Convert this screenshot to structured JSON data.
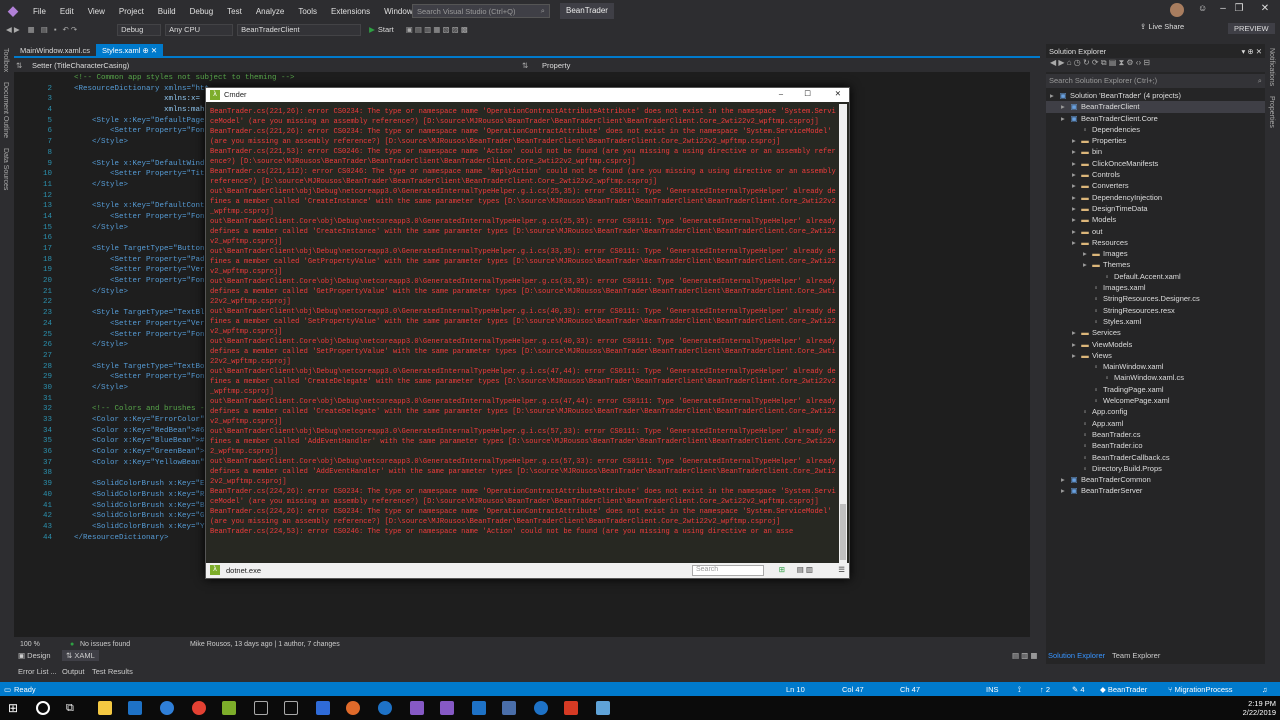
{
  "app": {
    "menu": [
      "File",
      "Edit",
      "View",
      "Project",
      "Build",
      "Debug",
      "Test",
      "Analyze",
      "Tools",
      "Extensions",
      "Window",
      "Help"
    ],
    "search_placeholder": "Search Visual Studio (Ctrl+Q)",
    "solution": "BeanTrader",
    "liveshare": "Live Share",
    "preview": "PREVIEW"
  },
  "toolbar": {
    "config": "Debug",
    "platform": "Any CPU",
    "startup": "BeanTraderClient",
    "start": "Start"
  },
  "left_tabs": [
    "Toolbox",
    "Document Outline",
    "Data Sources"
  ],
  "right_tabs": [
    "Notifications",
    "Properties"
  ],
  "doc_tabs": [
    {
      "label": "MainWindow.xaml.cs"
    },
    {
      "label": "Styles.xaml"
    }
  ],
  "nav": {
    "left": "Setter (TitleCharacterCasing)",
    "right": "Property"
  },
  "code": [
    {
      "n": "",
      "t": "<!-- Common app styles not subject to theming -->",
      "c": "ccom",
      "i": 4
    },
    {
      "n": "2",
      "t": "<ResourceDictionary xmlns=\"htt",
      "c": "cxml",
      "i": 0
    },
    {
      "n": "3",
      "t": "                    xmlns:x=",
      "c": "cattr",
      "i": 0
    },
    {
      "n": "4",
      "t": "                    xmlns:mah",
      "c": "cattr",
      "i": 0
    },
    {
      "n": "5",
      "t": "    <Style x:Key=\"DefaultPageS",
      "c": "cxml",
      "i": 0
    },
    {
      "n": "6",
      "t": "        <Setter Property=\"Font",
      "c": "cxml",
      "i": 0
    },
    {
      "n": "7",
      "t": "    </Style>",
      "c": "cxml",
      "i": 0
    },
    {
      "n": "8",
      "t": "",
      "c": "ctext",
      "i": 0
    },
    {
      "n": "9",
      "t": "    <Style x:Key=\"DefaultWindo",
      "c": "cxml",
      "i": 0
    },
    {
      "n": "10",
      "t": "        <Setter Property=\"Tit",
      "c": "cxml",
      "i": 0
    },
    {
      "n": "11",
      "t": "    </Style>",
      "c": "cxml",
      "i": 0
    },
    {
      "n": "12",
      "t": "",
      "c": "ctext",
      "i": 0
    },
    {
      "n": "13",
      "t": "    <Style x:Key=\"DefaultContr",
      "c": "cxml",
      "i": 0
    },
    {
      "n": "14",
      "t": "        <Setter Property=\"Font",
      "c": "cxml",
      "i": 0
    },
    {
      "n": "15",
      "t": "    </Style>",
      "c": "cxml",
      "i": 0
    },
    {
      "n": "16",
      "t": "",
      "c": "ctext",
      "i": 0
    },
    {
      "n": "17",
      "t": "    <Style TargetType=\"Button\"",
      "c": "cxml",
      "i": 0
    },
    {
      "n": "18",
      "t": "        <Setter Property=\"Padd",
      "c": "cxml",
      "i": 0
    },
    {
      "n": "19",
      "t": "        <Setter Property=\"Vert",
      "c": "cxml",
      "i": 0
    },
    {
      "n": "20",
      "t": "        <Setter Property=\"Font",
      "c": "cxml",
      "i": 0
    },
    {
      "n": "21",
      "t": "    </Style>",
      "c": "cxml",
      "i": 0
    },
    {
      "n": "22",
      "t": "",
      "c": "ctext",
      "i": 0
    },
    {
      "n": "23",
      "t": "    <Style TargetType=\"TextBlo",
      "c": "cxml",
      "i": 0
    },
    {
      "n": "24",
      "t": "        <Setter Property=\"Vert",
      "c": "cxml",
      "i": 0
    },
    {
      "n": "25",
      "t": "        <Setter Property=\"Font",
      "c": "cxml",
      "i": 0
    },
    {
      "n": "26",
      "t": "    </Style>",
      "c": "cxml",
      "i": 0
    },
    {
      "n": "27",
      "t": "",
      "c": "ctext",
      "i": 0
    },
    {
      "n": "28",
      "t": "    <Style TargetType=\"TextBox",
      "c": "cxml",
      "i": 0
    },
    {
      "n": "29",
      "t": "        <Setter Property=\"Font",
      "c": "cxml",
      "i": 0
    },
    {
      "n": "30",
      "t": "    </Style>",
      "c": "cxml",
      "i": 0
    },
    {
      "n": "31",
      "t": "",
      "c": "ctext",
      "i": 0
    },
    {
      "n": "32",
      "t": "    <!-- Colors and brushes --",
      "c": "ccom",
      "i": 0
    },
    {
      "n": "33",
      "t": "    <Color x:Key=\"ErrorColor\"",
      "c": "cxml",
      "i": 0
    },
    {
      "n": "34",
      "t": "    <Color x:Key=\"RedBean\">#67",
      "c": "cxml",
      "i": 0
    },
    {
      "n": "35",
      "t": "    <Color x:Key=\"BlueBean\">#1",
      "c": "cxml",
      "i": 0
    },
    {
      "n": "36",
      "t": "    <Color x:Key=\"GreenBean\">#",
      "c": "cxml",
      "i": 0
    },
    {
      "n": "37",
      "t": "    <Color x:Key=\"YellowBean\"",
      "c": "cxml",
      "i": 0
    },
    {
      "n": "38",
      "t": "",
      "c": "ctext",
      "i": 0
    },
    {
      "n": "39",
      "t": "    <SolidColorBrush x:Key=\"Er",
      "c": "cxml",
      "i": 0
    },
    {
      "n": "40",
      "t": "    <SolidColorBrush x:Key=\"Re",
      "c": "cxml",
      "i": 0
    },
    {
      "n": "41",
      "t": "    <SolidColorBrush x:Key=\"Bl",
      "c": "cxml",
      "i": 0
    },
    {
      "n": "42",
      "t": "    <SolidColorBrush x:Key=\"Gr",
      "c": "cxml",
      "i": 0
    },
    {
      "n": "43",
      "t": "    <SolidColorBrush x:Key=\"Ye",
      "c": "cxml",
      "i": 0
    },
    {
      "n": "44",
      "t": "</ResourceDictionary>",
      "c": "cxml",
      "i": 0
    }
  ],
  "cmder": {
    "title": "Cmder",
    "tab": "dotnet.exe",
    "search": "Search",
    "lines": [
      "BeanTrader.cs(221,26): error CS0234: The type or namespace name 'OperationContractAttributeAttribute' does not exist in the namespace 'System.ServiceModel' (are you missing an assembly reference?) [D:\\source\\MJRousos\\BeanTrader\\BeanTraderClient\\BeanTraderClient.Core_2wti22v2_wpftmp.csproj]",
      "BeanTrader.cs(221,26): error CS0234: The type or namespace name 'OperationContractAttribute' does not exist in the namespace 'System.ServiceModel' (are you missing an assembly reference?) [D:\\source\\MJRousos\\BeanTrader\\BeanTraderClient\\BeanTraderClient.Core_2wti22v2_wpftmp.csproj]",
      "BeanTrader.cs(221,53): error CS0246: The type or namespace name 'Action' could not be found (are you missing a using directive or an assembly reference?) [D:\\source\\MJRousos\\BeanTrader\\BeanTraderClient\\BeanTraderClient.Core_2wti22v2_wpftmp.csproj]",
      "BeanTrader.cs(221,112): error CS0246: The type or namespace name 'ReplyAction' could not be found (are you missing a using directive or an assembly reference?) [D:\\source\\MJRousos\\BeanTrader\\BeanTraderClient\\BeanTraderClient.Core_2wti22v2_wpftmp.csproj]",
      "out\\BeanTraderClient\\obj\\Debug\\netcoreapp3.0\\GeneratedInternalTypeHelper.g.i.cs(25,35): error CS0111: Type 'GeneratedInternalTypeHelper' already defines a member called 'CreateInstance' with the same parameter types [D:\\source\\MJRousos\\BeanTrader\\BeanTraderClient\\BeanTraderClient.Core_2wti22v2_wpftmp.csproj]",
      "out\\BeanTraderClient.Core\\obj\\Debug\\netcoreapp3.0\\GeneratedInternalTypeHelper.g.cs(25,35): error CS0111: Type 'GeneratedInternalTypeHelper' already defines a member called 'CreateInstance' with the same parameter types [D:\\source\\MJRousos\\BeanTrader\\BeanTraderClient\\BeanTraderClient.Core_2wti22v2_wpftmp.csproj]",
      "out\\BeanTraderClient\\obj\\Debug\\netcoreapp3.0\\GeneratedInternalTypeHelper.g.i.cs(33,35): error CS0111: Type 'GeneratedInternalTypeHelper' already defines a member called 'GetPropertyValue' with the same parameter types [D:\\source\\MJRousos\\BeanTrader\\BeanTraderClient\\BeanTraderClient.Core_2wti22v2_wpftmp.csproj]",
      "out\\BeanTraderClient.Core\\obj\\Debug\\netcoreapp3.0\\GeneratedInternalTypeHelper.g.cs(33,35): error CS0111: Type 'GeneratedInternalTypeHelper' already defines a member called 'GetPropertyValue' with the same parameter types [D:\\source\\MJRousos\\BeanTrader\\BeanTraderClient\\BeanTraderClient.Core_2wti22v2_wpftmp.csproj]",
      "out\\BeanTraderClient\\obj\\Debug\\netcoreapp3.0\\GeneratedInternalTypeHelper.g.i.cs(40,33): error CS0111: Type 'GeneratedInternalTypeHelper' already defines a member called 'SetPropertyValue' with the same parameter types [D:\\source\\MJRousos\\BeanTrader\\BeanTraderClient\\BeanTraderClient.Core_2wti22v2_wpftmp.csproj]",
      "out\\BeanTraderClient.Core\\obj\\Debug\\netcoreapp3.0\\GeneratedInternalTypeHelper.g.cs(40,33): error CS0111: Type 'GeneratedInternalTypeHelper' already defines a member called 'SetPropertyValue' with the same parameter types [D:\\source\\MJRousos\\BeanTrader\\BeanTraderClient\\BeanTraderClient.Core_2wti22v2_wpftmp.csproj]",
      "out\\BeanTraderClient\\obj\\Debug\\netcoreapp3.0\\GeneratedInternalTypeHelper.g.i.cs(47,44): error CS0111: Type 'GeneratedInternalTypeHelper' already defines a member called 'CreateDelegate' with the same parameter types [D:\\source\\MJRousos\\BeanTrader\\BeanTraderClient\\BeanTraderClient.Core_2wti22v2_wpftmp.csproj]",
      "out\\BeanTraderClient.Core\\obj\\Debug\\netcoreapp3.0\\GeneratedInternalTypeHelper.g.cs(47,44): error CS0111: Type 'GeneratedInternalTypeHelper' already defines a member called 'CreateDelegate' with the same parameter types [D:\\source\\MJRousos\\BeanTrader\\BeanTraderClient\\BeanTraderClient.Core_2wti22v2_wpftmp.csproj]",
      "out\\BeanTraderClient\\obj\\Debug\\netcoreapp3.0\\GeneratedInternalTypeHelper.g.i.cs(57,33): error CS0111: Type 'GeneratedInternalTypeHelper' already defines a member called 'AddEventHandler' with the same parameter types [D:\\source\\MJRousos\\BeanTrader\\BeanTraderClient\\BeanTraderClient.Core_2wti22v2_wpftmp.csproj]",
      "out\\BeanTraderClient.Core\\obj\\Debug\\netcoreapp3.0\\GeneratedInternalTypeHelper.g.cs(57,33): error CS0111: Type 'GeneratedInternalTypeHelper' already defines a member called 'AddEventHandler' with the same parameter types [D:\\source\\MJRousos\\BeanTrader\\BeanTraderClient\\BeanTraderClient.Core_2wti22v2_wpftmp.csproj]",
      "BeanTrader.cs(224,26): error CS0234: The type or namespace name 'OperationContractAttributeAttribute' does not exist in the namespace 'System.ServiceModel' (are you missing an assembly reference?) [D:\\source\\MJRousos\\BeanTrader\\BeanTraderClient\\BeanTraderClient.Core_2wti22v2_wpftmp.csproj]",
      "BeanTrader.cs(224,26): error CS0234: The type or namespace name 'OperationContractAttribute' does not exist in the namespace 'System.ServiceModel' (are you missing an assembly reference?) [D:\\source\\MJRousos\\BeanTrader\\BeanTraderClient\\BeanTraderClient.Core_2wti22v2_wpftmp.csproj]",
      "BeanTrader.cs(224,53): error CS0246: The type or namespace name 'Action' could not be found (are you missing a using directive or an asse"
    ]
  },
  "editor_status": {
    "zoom": "100 %",
    "issues": "No issues found",
    "blame": "Mike Rousos, 13 days ago | 1 author, 7 changes"
  },
  "design_tabs": {
    "design": "Design",
    "xaml": "XAML"
  },
  "bottom_tabs": [
    "Error List ...",
    "Output",
    "Test Results"
  ],
  "solution_explorer": {
    "title": "Solution Explorer",
    "search": "Search Solution Explorer (Ctrl+;)",
    "items": [
      {
        "label": "Solution 'BeanTrader' (4 projects)",
        "d": 0,
        "k": "proj"
      },
      {
        "label": "BeanTraderClient",
        "d": 1,
        "k": "proj"
      },
      {
        "label": "BeanTraderClient.Core",
        "d": 1,
        "k": "proj"
      },
      {
        "label": "Dependencies",
        "d": 2,
        "k": "file"
      },
      {
        "label": "Properties",
        "d": 2,
        "k": "dir"
      },
      {
        "label": "bin",
        "d": 2,
        "k": "dir"
      },
      {
        "label": "ClickOnceManifests",
        "d": 2,
        "k": "dir"
      },
      {
        "label": "Controls",
        "d": 2,
        "k": "dir"
      },
      {
        "label": "Converters",
        "d": 2,
        "k": "dir"
      },
      {
        "label": "DependencyInjection",
        "d": 2,
        "k": "dir"
      },
      {
        "label": "DesignTimeData",
        "d": 2,
        "k": "dir"
      },
      {
        "label": "Models",
        "d": 2,
        "k": "dir"
      },
      {
        "label": "out",
        "d": 2,
        "k": "dir"
      },
      {
        "label": "Resources",
        "d": 2,
        "k": "dir"
      },
      {
        "label": "Images",
        "d": 3,
        "k": "dir"
      },
      {
        "label": "Themes",
        "d": 3,
        "k": "dir"
      },
      {
        "label": "Default.Accent.xaml",
        "d": 4,
        "k": "file"
      },
      {
        "label": "Images.xaml",
        "d": 3,
        "k": "file"
      },
      {
        "label": "StringResources.Designer.cs",
        "d": 3,
        "k": "file"
      },
      {
        "label": "StringResources.resx",
        "d": 3,
        "k": "file"
      },
      {
        "label": "Styles.xaml",
        "d": 3,
        "k": "file"
      },
      {
        "label": "Services",
        "d": 2,
        "k": "dir"
      },
      {
        "label": "ViewModels",
        "d": 2,
        "k": "dir"
      },
      {
        "label": "Views",
        "d": 2,
        "k": "dir"
      },
      {
        "label": "MainWindow.xaml",
        "d": 3,
        "k": "file"
      },
      {
        "label": "MainWindow.xaml.cs",
        "d": 4,
        "k": "file"
      },
      {
        "label": "TradingPage.xaml",
        "d": 3,
        "k": "file"
      },
      {
        "label": "WelcomePage.xaml",
        "d": 3,
        "k": "file"
      },
      {
        "label": "App.config",
        "d": 2,
        "k": "file"
      },
      {
        "label": "App.xaml",
        "d": 2,
        "k": "file"
      },
      {
        "label": "BeanTrader.cs",
        "d": 2,
        "k": "file"
      },
      {
        "label": "BeanTrader.ico",
        "d": 2,
        "k": "file"
      },
      {
        "label": "BeanTraderCallback.cs",
        "d": 2,
        "k": "file"
      },
      {
        "label": "Directory.Build.Props",
        "d": 2,
        "k": "file"
      },
      {
        "label": "BeanTraderCommon",
        "d": 1,
        "k": "proj"
      },
      {
        "label": "BeanTraderServer",
        "d": 1,
        "k": "proj"
      }
    ],
    "tabs": [
      "Solution Explorer",
      "Team Explorer"
    ]
  },
  "statusbar": {
    "ready": "Ready",
    "ln": "Ln 10",
    "col": "Col 47",
    "ch": "Ch 47",
    "ins": "INS",
    "up": "2",
    "pencil": "4",
    "repo": "BeanTrader",
    "branch": "MigrationProcess"
  },
  "clock": {
    "time": "2:19 PM",
    "date": "2/22/2019"
  }
}
